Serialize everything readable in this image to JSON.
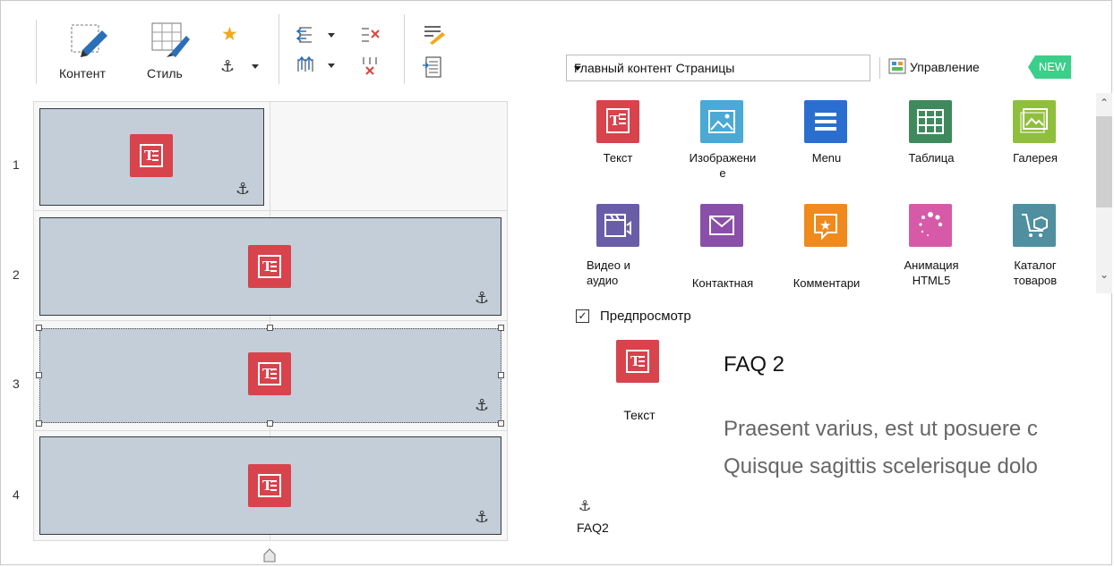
{
  "toolbar": {
    "content_label": "Контент",
    "style_label": "Стиль"
  },
  "grid": {
    "rows": [
      "1",
      "2",
      "3",
      "4"
    ]
  },
  "panel": {
    "dropdown_value": "Главный контент Страницы",
    "management_label": "Управление",
    "new_badge": "NEW",
    "tiles": [
      {
        "label": "Текст",
        "icon": "text-icon",
        "color": "#d8434c"
      },
      {
        "label": "Изображени\nе",
        "icon": "image-icon",
        "color": "#4aa9d5"
      },
      {
        "label": "Menu",
        "icon": "menu-icon",
        "color": "#2a6fcf"
      },
      {
        "label": "Таблица",
        "icon": "table-icon",
        "color": "#3f8a5d"
      },
      {
        "label": "Галерея",
        "icon": "gallery-icon",
        "color": "#8fbf3c"
      },
      {
        "label": "Видео и\nаудио",
        "icon": "video-icon",
        "color": "#6a5da8"
      },
      {
        "label": "Контактная",
        "icon": "mail-icon",
        "color": "#8a4fa8"
      },
      {
        "label": "Комментари",
        "icon": "comment-star-icon",
        "color": "#f08a1c"
      },
      {
        "label": "Анимация\nHTML5",
        "icon": "animation-icon",
        "color": "#d65aa8"
      },
      {
        "label": "Каталог\nтоваров",
        "icon": "catalog-icon",
        "color": "#4f8fa0"
      }
    ]
  },
  "preview": {
    "label": "Предпросмотр",
    "checked": true,
    "item_label": "Текст",
    "title": "FAQ 2",
    "line1": "Praesent varius, est ut posuere c",
    "line2": "Quisque sagittis scelerisque dolo",
    "anchor_name": "FAQ2"
  }
}
